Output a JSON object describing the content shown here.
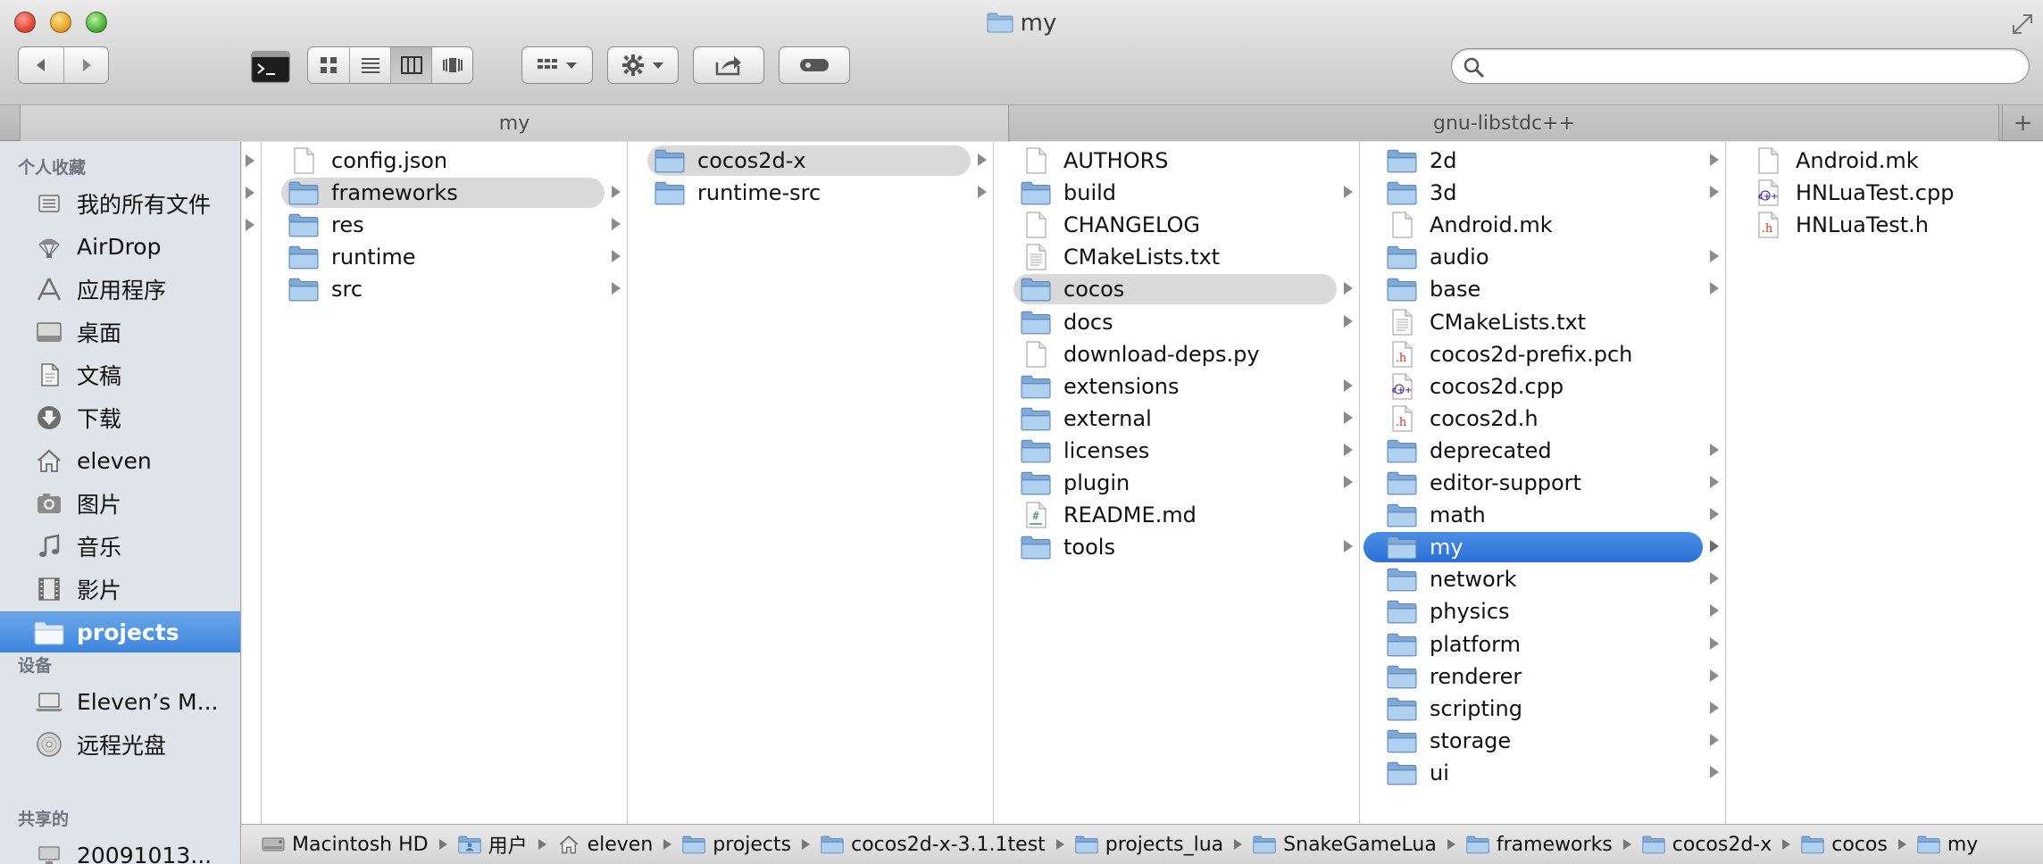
{
  "window": {
    "title": "my"
  },
  "toolbar": {
    "search_placeholder": ""
  },
  "tabs": [
    {
      "label": "my"
    },
    {
      "label": "gnu-libstdc++"
    }
  ],
  "sidebar": {
    "sections": [
      {
        "header": "个人收藏",
        "items": [
          {
            "label": "我的所有文件",
            "icon": "all-files-icon"
          },
          {
            "label": "AirDrop",
            "icon": "airdrop-icon"
          },
          {
            "label": "应用程序",
            "icon": "applications-icon"
          },
          {
            "label": "桌面",
            "icon": "desktop-icon"
          },
          {
            "label": "文稿",
            "icon": "documents-icon"
          },
          {
            "label": "下载",
            "icon": "downloads-icon"
          },
          {
            "label": "eleven",
            "icon": "home-icon"
          },
          {
            "label": "图片",
            "icon": "pictures-icon"
          },
          {
            "label": "音乐",
            "icon": "music-icon"
          },
          {
            "label": "影片",
            "icon": "movies-icon"
          },
          {
            "label": "projects",
            "icon": "folder-icon",
            "selected": true
          }
        ]
      },
      {
        "header": "设备",
        "items": [
          {
            "label": "Eleven’s M...",
            "icon": "laptop-icon"
          },
          {
            "label": "远程光盘",
            "icon": "remote-disc-icon"
          }
        ]
      },
      {
        "header": "共享的",
        "items": [
          {
            "label": "20091013...",
            "icon": "network-computer-icon"
          }
        ]
      }
    ]
  },
  "columns": [
    {
      "items": [
        {
          "name": "config.json",
          "type": "file"
        },
        {
          "name": "frameworks",
          "type": "folder",
          "selected": "grey"
        },
        {
          "name": "res",
          "type": "folder"
        },
        {
          "name": "runtime",
          "type": "folder"
        },
        {
          "name": "src",
          "type": "folder"
        }
      ]
    },
    {
      "items": [
        {
          "name": "cocos2d-x",
          "type": "folder",
          "selected": "grey"
        },
        {
          "name": "runtime-src",
          "type": "folder"
        }
      ]
    },
    {
      "items": [
        {
          "name": "AUTHORS",
          "type": "file"
        },
        {
          "name": "build",
          "type": "folder"
        },
        {
          "name": "CHANGELOG",
          "type": "file"
        },
        {
          "name": "CMakeLists.txt",
          "type": "text"
        },
        {
          "name": "cocos",
          "type": "folder",
          "selected": "grey"
        },
        {
          "name": "docs",
          "type": "folder"
        },
        {
          "name": "download-deps.py",
          "type": "file"
        },
        {
          "name": "extensions",
          "type": "folder"
        },
        {
          "name": "external",
          "type": "folder"
        },
        {
          "name": "licenses",
          "type": "folder"
        },
        {
          "name": "plugin",
          "type": "folder"
        },
        {
          "name": "README.md",
          "type": "markdown"
        },
        {
          "name": "tools",
          "type": "folder"
        }
      ]
    },
    {
      "items": [
        {
          "name": "2d",
          "type": "folder"
        },
        {
          "name": "3d",
          "type": "folder"
        },
        {
          "name": "Android.mk",
          "type": "file"
        },
        {
          "name": "audio",
          "type": "folder"
        },
        {
          "name": "base",
          "type": "folder"
        },
        {
          "name": "CMakeLists.txt",
          "type": "text"
        },
        {
          "name": "cocos2d-prefix.pch",
          "type": "header"
        },
        {
          "name": "cocos2d.cpp",
          "type": "cpp"
        },
        {
          "name": "cocos2d.h",
          "type": "header"
        },
        {
          "name": "deprecated",
          "type": "folder"
        },
        {
          "name": "editor-support",
          "type": "folder"
        },
        {
          "name": "math",
          "type": "folder"
        },
        {
          "name": "my",
          "type": "folder",
          "selected": "blue"
        },
        {
          "name": "network",
          "type": "folder"
        },
        {
          "name": "physics",
          "type": "folder"
        },
        {
          "name": "platform",
          "type": "folder"
        },
        {
          "name": "renderer",
          "type": "folder"
        },
        {
          "name": "scripting",
          "type": "folder"
        },
        {
          "name": "storage",
          "type": "folder"
        },
        {
          "name": "ui",
          "type": "folder"
        }
      ]
    },
    {
      "items": [
        {
          "name": "Android.mk",
          "type": "file"
        },
        {
          "name": "HNLuaTest.cpp",
          "type": "cpp"
        },
        {
          "name": "HNLuaTest.h",
          "type": "header"
        }
      ]
    }
  ],
  "pathbar": [
    {
      "label": "Macintosh HD",
      "icon": "hard-drive-icon"
    },
    {
      "label": "用户",
      "icon": "users-folder-icon"
    },
    {
      "label": "eleven",
      "icon": "home-icon"
    },
    {
      "label": "projects",
      "icon": "folder-icon"
    },
    {
      "label": "cocos2d-x-3.1.1test",
      "icon": "folder-icon"
    },
    {
      "label": "projects_lua",
      "icon": "folder-icon"
    },
    {
      "label": "SnakeGameLua",
      "icon": "folder-icon"
    },
    {
      "label": "frameworks",
      "icon": "folder-icon"
    },
    {
      "label": "cocos2d-x",
      "icon": "folder-icon"
    },
    {
      "label": "cocos",
      "icon": "folder-icon"
    },
    {
      "label": "my",
      "icon": "folder-icon"
    }
  ]
}
